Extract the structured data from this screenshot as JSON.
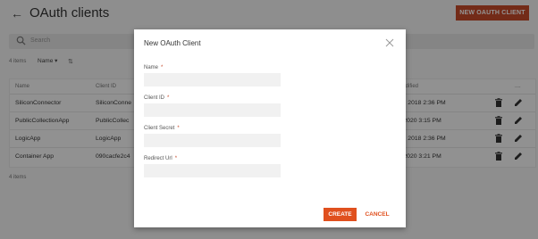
{
  "header": {
    "title": "OAuth clients",
    "new_button": "NEW OAUTH CLIENT"
  },
  "search": {
    "placeholder": "Search"
  },
  "list": {
    "count": "4 items",
    "sort_label": "Name ▾"
  },
  "table": {
    "headers": {
      "name": "Name",
      "client_id": "Client ID",
      "date_modified": "Date modified",
      "actions": "...."
    },
    "rows": [
      {
        "name": "SiliconConnector",
        "client_id": "SiliconConne",
        "date_modified": "Nov 29, 2018 2:36 PM"
      },
      {
        "name": "PublicCollectionApp",
        "client_id": "PublicCollec",
        "date_modified": "Jan 8, 2020 3:15 PM"
      },
      {
        "name": "LogicApp",
        "client_id": "LogicApp",
        "date_modified": "Nov 29, 2018 2:36 PM"
      },
      {
        "name": "Container App",
        "client_id": "090cacfe2c4",
        "date_modified": "Jan 8, 2020 3:21 PM"
      }
    ]
  },
  "footer": {
    "count": "4 items"
  },
  "modal": {
    "title": "New OAuth Client",
    "fields": [
      {
        "label": "Name",
        "value": ""
      },
      {
        "label": "Client ID",
        "value": ""
      },
      {
        "label": "Client Secret",
        "value": ""
      },
      {
        "label": "Redirect Url",
        "value": ""
      }
    ],
    "required_marker": "*",
    "create_label": "CREATE",
    "cancel_label": "CANCEL"
  },
  "colors": {
    "accent": "#c64a2a",
    "overlay": "rgba(0,0,0,0.42)"
  },
  "icons": [
    "back-arrow-icon",
    "search-icon",
    "sort-icon",
    "delete-icon",
    "edit-icon",
    "close-icon"
  ]
}
